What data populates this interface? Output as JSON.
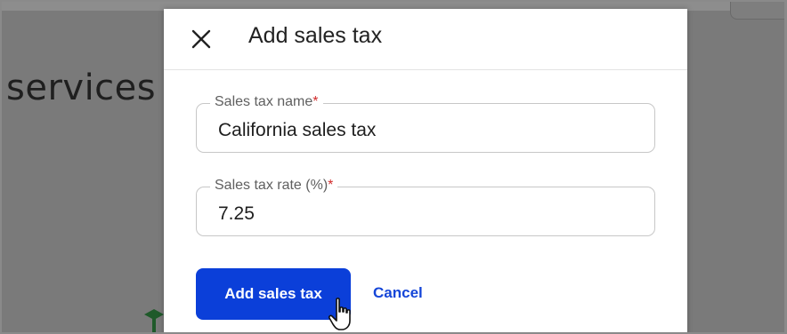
{
  "background": {
    "heading": "services"
  },
  "dialog": {
    "title": "Add sales tax",
    "close_icon": "close-icon",
    "fields": [
      {
        "label": "Sales tax name",
        "required_marker": "*",
        "value": "California sales tax"
      },
      {
        "label": "Sales tax rate (%)",
        "required_marker": "*",
        "value": "7.25"
      }
    ],
    "primary_button": "Add sales tax",
    "cancel_link": "Cancel"
  },
  "colors": {
    "primary": "#0b3fd9",
    "link": "#1546d8",
    "required": "#d12b2b",
    "overlay": "#7a7a7a"
  },
  "icons": {
    "cursor": "hand-pointer-icon",
    "background_icon": "graduation-cap-icon"
  }
}
